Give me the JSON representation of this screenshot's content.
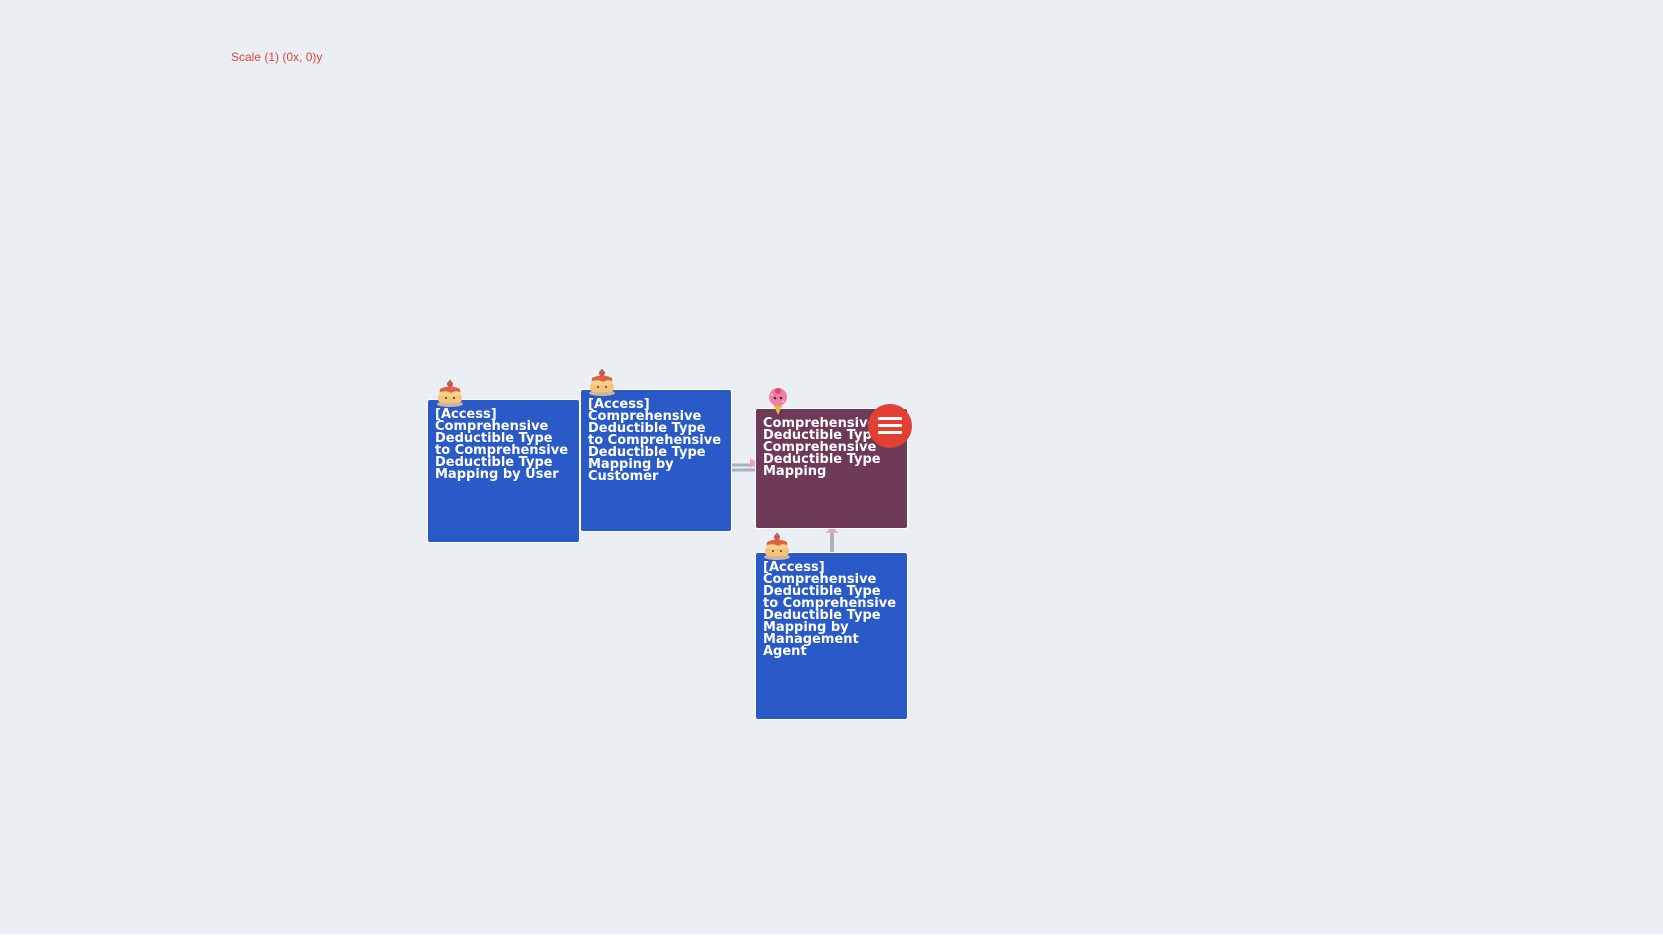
{
  "canvas": {
    "scale_label": "Scale (1) (0x, 0)y"
  },
  "colors": {
    "background": "#ebeef3",
    "access_node": "#2a5ac7",
    "entity_node": "#6e3a57",
    "menu_button": "#e24031",
    "scale_text": "#e5453a"
  },
  "nodes": [
    {
      "id": "access-by-user",
      "title": "[Access] Comprehensive Deductible Type to Comprehensive Deductible Type Mapping by User",
      "icon": "pancake-icon",
      "kind": "access"
    },
    {
      "id": "access-by-customer",
      "title": "[Access] Comprehensive Deductible Type to Comprehensive Deductible Type Mapping by Customer",
      "icon": "pancake-icon",
      "kind": "access"
    },
    {
      "id": "mapping-entity",
      "title": "Comprehensive Deductible Type Comprehensive Deductible Type Mapping",
      "icon": "ice-cream-icon",
      "kind": "entity"
    },
    {
      "id": "access-by-management-agent",
      "title": "[Access] Comprehensive Deductible Type to Comprehensive Deductible Type Mapping by Management Agent",
      "icon": "pancake-icon",
      "kind": "access"
    }
  ],
  "edges": [
    {
      "from": "access-by-user",
      "to": "mapping-entity"
    },
    {
      "from": "access-by-customer",
      "to": "mapping-entity"
    },
    {
      "from": "access-by-management-agent",
      "to": "mapping-entity"
    }
  ],
  "menu": {
    "icon": "hamburger-menu-icon"
  }
}
